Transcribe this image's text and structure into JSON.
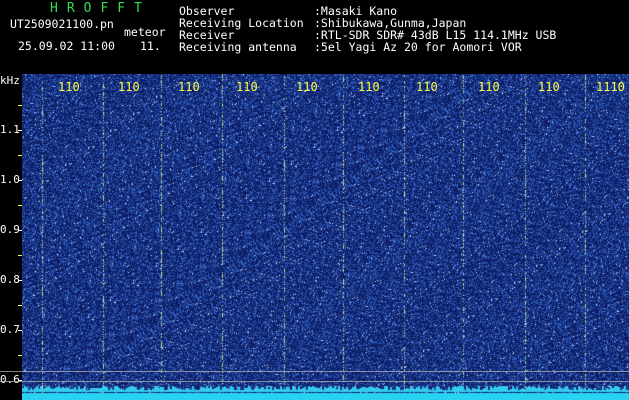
{
  "header": {
    "brand": "HROFFT",
    "filename": "UT2509021100.pn",
    "tag_meteor": "meteor",
    "datetime": "25.09.02 11:00",
    "counter": "11.",
    "rows": [
      {
        "label": "Observer",
        "value": ":Masaki Kano"
      },
      {
        "label": "Receiving Location",
        "value": ":Shibukawa,Gunma,Japan"
      },
      {
        "label": "Receiver",
        "value": ":RTL-SDR SDR# 43dB L15 114.1MHz USB"
      },
      {
        "label": "Receiving antenna",
        "value": ":5el Yagi Az 20 for Aomori VOR"
      }
    ]
  },
  "axis": {
    "y_unit": "kHz",
    "y_labels": [
      "1.1",
      "1.0",
      "0.9",
      "0.8",
      "0.7",
      "0.6"
    ],
    "x_labels": [
      "110",
      "110",
      "110",
      "110",
      "110",
      "110",
      "110",
      "110",
      "110",
      "1110"
    ]
  },
  "colors": {
    "background": "#000000",
    "waterfall_base": "#0a1a6a",
    "brand": "#33dd55",
    "time_labels": "#ffff44",
    "baseline": "#33ccee"
  }
}
